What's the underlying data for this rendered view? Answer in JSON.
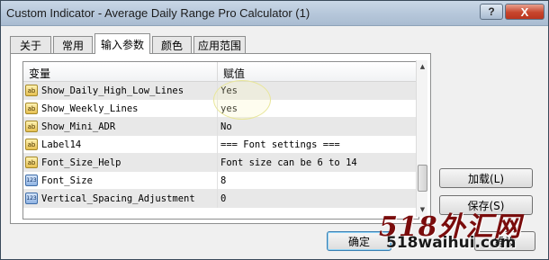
{
  "window": {
    "title": "Custom Indicator - Average Daily Range Pro Calculator (1)",
    "help_glyph": "?",
    "close_glyph": "X"
  },
  "tabs": [
    {
      "label": "关于"
    },
    {
      "label": "常用"
    },
    {
      "label": "输入参数"
    },
    {
      "label": "颜色"
    },
    {
      "label": "应用范围"
    }
  ],
  "active_tab": "输入参数",
  "grid": {
    "col_variable": "变量",
    "col_value": "赋值",
    "rows": [
      {
        "type_icon": "ab",
        "name": "Show_Daily_High_Low_Lines",
        "value": "Yes"
      },
      {
        "type_icon": "ab",
        "name": "Show_Weekly_Lines",
        "value": "yes"
      },
      {
        "type_icon": "ab",
        "name": "Show_Mini_ADR",
        "value": "No"
      },
      {
        "type_icon": "ab",
        "name": "Label14",
        "value": "=== Font settings ==="
      },
      {
        "type_icon": "ab",
        "name": "Font_Size_Help",
        "value": "Font size can be 6 to 14"
      },
      {
        "type_icon": "123",
        "name": "Font_Size",
        "value": "8"
      },
      {
        "type_icon": "123",
        "name": "Vertical_Spacing_Adjustment",
        "value": "0"
      }
    ]
  },
  "scrollbar": {
    "up_glyph": "▲",
    "down_glyph": "▼"
  },
  "buttons": {
    "load": "加载(L)",
    "save": "保存(S)",
    "ok": "确定",
    "reset": "重设"
  },
  "watermark": {
    "logo_text": "518外汇网",
    "site_text": "518waihui.com"
  }
}
